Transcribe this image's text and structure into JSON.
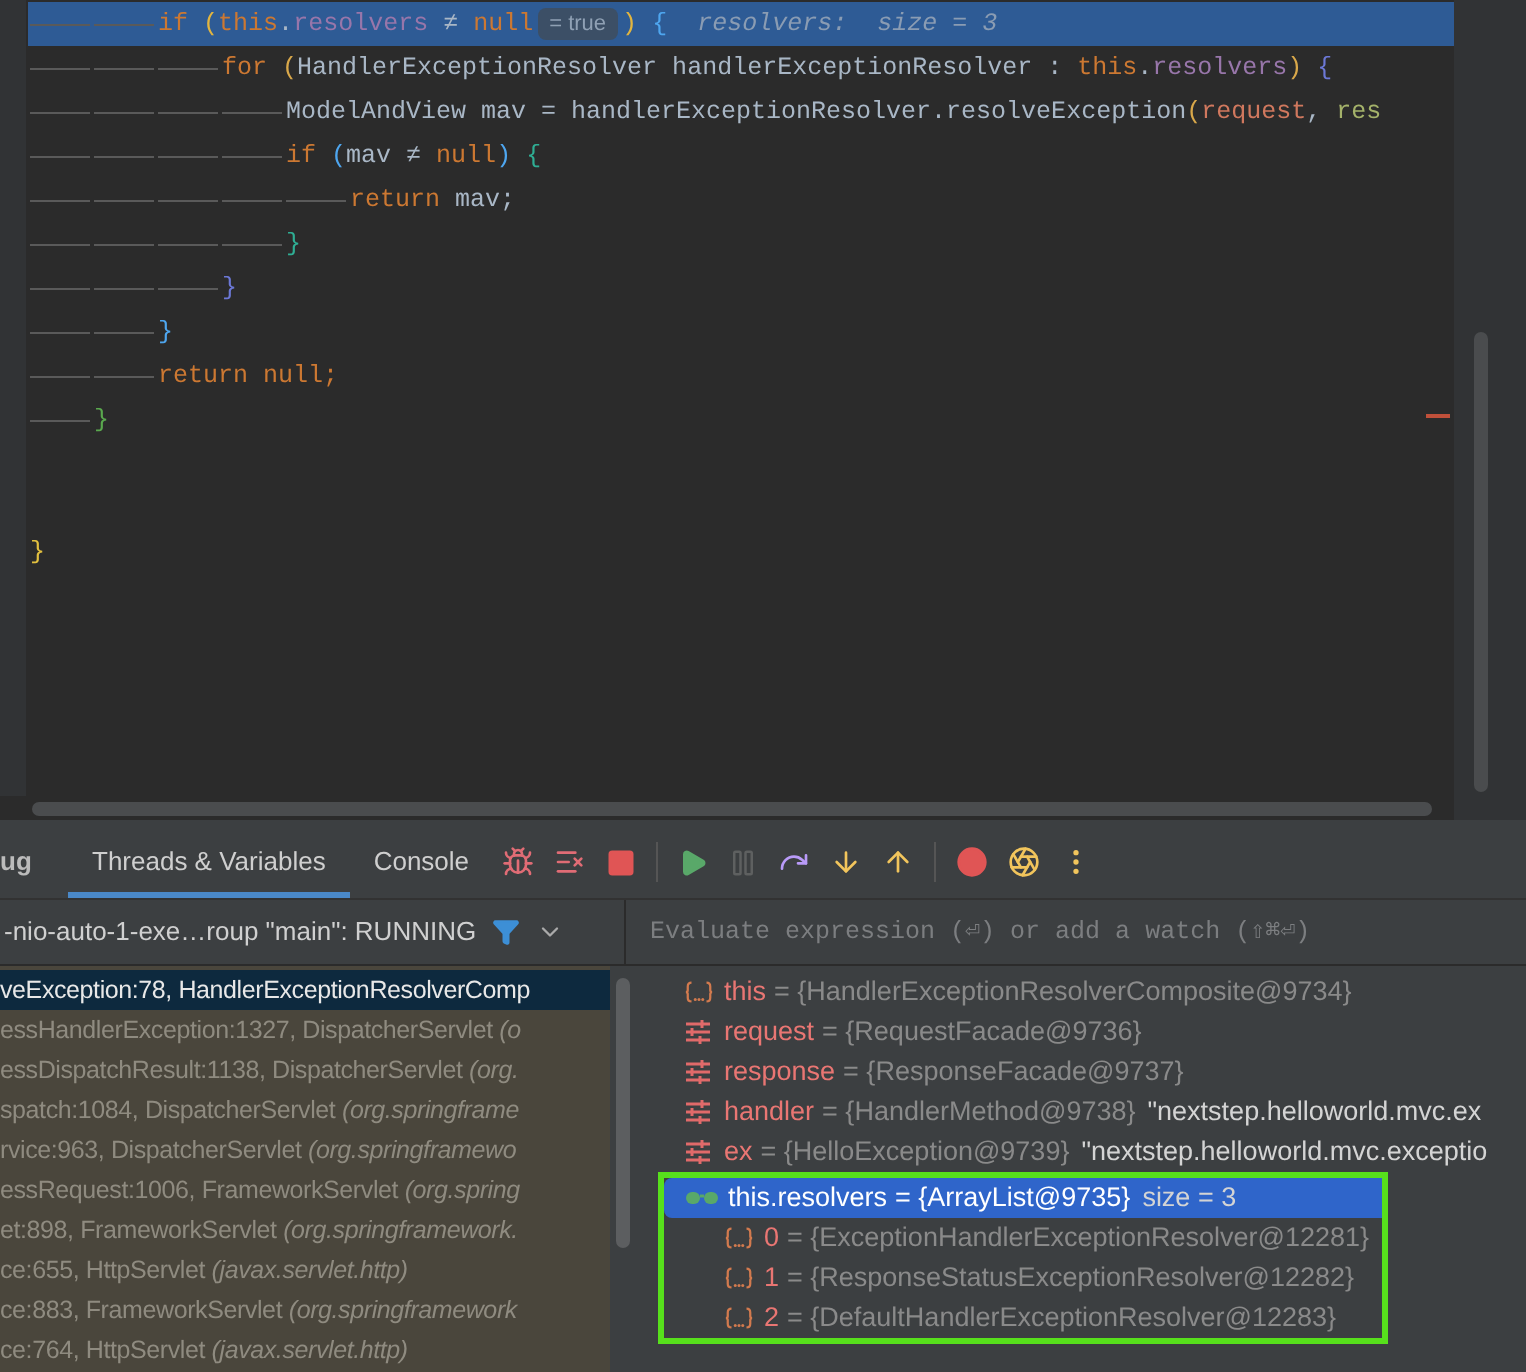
{
  "editor": {
    "lines": [
      {
        "children": [
          {
            "children": [
              {
                "highlighted": true,
                "tokens": [
                  {
                    "kind": "keyword",
                    "text": "if "
                  },
                  {
                    "kind": "bracket",
                    "text": "(",
                    "color": "#e2b53f"
                  },
                  {
                    "kind": "keyword",
                    "text": "this"
                  },
                  {
                    "kind": "plain",
                    "text": "."
                  },
                  {
                    "kind": "field",
                    "text": "resolvers"
                  },
                  {
                    "kind": "plain",
                    "text": " ≠ "
                  },
                  {
                    "kind": "keyword",
                    "text": "null"
                  },
                  {
                    "kind": "hint",
                    "text": "= true"
                  },
                  {
                    "kind": "bracket",
                    "text": ")",
                    "color": "#e2b53f"
                  },
                  {
                    "kind": "bracket",
                    "text": " {",
                    "color": "#4ea6ef"
                  },
                  {
                    "kind": "inline-value",
                    "text": "  resolvers:  size = 3"
                  }
                ],
                "children": [
                  {
                    "highlighted": false,
                    "tokens": [
                      {
                        "kind": "keyword",
                        "text": "for "
                      },
                      {
                        "kind": "bracket",
                        "text": "(",
                        "color": "#d9a84a"
                      },
                      {
                        "kind": "plain",
                        "text": "HandlerExceptionResolver handlerExceptionResolver : "
                      },
                      {
                        "kind": "keyword",
                        "text": "this"
                      },
                      {
                        "kind": "plain",
                        "text": "."
                      },
                      {
                        "kind": "field",
                        "text": "resolvers"
                      },
                      {
                        "kind": "bracket",
                        "text": ")",
                        "color": "#d9a84a"
                      },
                      {
                        "kind": "bracket",
                        "text": " {",
                        "color": "#6c78d6"
                      }
                    ],
                    "children": [
                      {
                        "highlighted": false,
                        "tokens": [
                          {
                            "kind": "plain",
                            "text": "ModelAndView mav = handlerExceptionResolver.resolveException"
                          },
                          {
                            "kind": "bracket",
                            "text": "(",
                            "color": "#d9a84a"
                          },
                          {
                            "kind": "param",
                            "text": "request"
                          },
                          {
                            "kind": "plain",
                            "text": ", "
                          },
                          {
                            "kind": "param-alt",
                            "text": "res"
                          }
                        ]
                      },
                      {
                        "highlighted": false,
                        "tokens": [
                          {
                            "kind": "keyword",
                            "text": "if "
                          },
                          {
                            "kind": "bracket",
                            "text": "(",
                            "color": "#4ea6ef"
                          },
                          {
                            "kind": "plain",
                            "text": "mav ≠ "
                          },
                          {
                            "kind": "keyword",
                            "text": "null"
                          },
                          {
                            "kind": "bracket",
                            "text": ")",
                            "color": "#4ea6ef"
                          },
                          {
                            "kind": "bracket",
                            "text": " {",
                            "color": "#2fae94"
                          }
                        ],
                        "children": [
                          {
                            "highlighted": false,
                            "tokens": [
                              {
                                "kind": "keyword",
                                "text": "return"
                              },
                              {
                                "kind": "plain",
                                "text": " mav;"
                              }
                            ]
                          }
                        ]
                      },
                      {
                        "highlighted": false,
                        "tokens": [
                          {
                            "kind": "bracket",
                            "text": "}",
                            "color": "#2fae94"
                          }
                        ]
                      }
                    ]
                  },
                  {
                    "highlighted": false,
                    "tokens": [
                      {
                        "kind": "bracket",
                        "text": "}",
                        "color": "#6c78d6"
                      }
                    ]
                  }
                ]
              },
              {
                "highlighted": false,
                "tokens": [
                  {
                    "kind": "bracket",
                    "text": "}",
                    "color": "#4ea6ef"
                  }
                ]
              },
              {
                "highlighted": false,
                "tokens": [
                  {
                    "kind": "keyword",
                    "text": "return null;"
                  }
                ]
              }
            ]
          },
          {
            "highlighted": false,
            "tokens": [
              {
                "kind": "bracket",
                "text": "}",
                "color": "#5aa84e"
              }
            ]
          }
        ]
      },
      {
        "kind": "blank"
      },
      {
        "kind": "blank"
      },
      {
        "highlighted": false,
        "tokens": [
          {
            "kind": "bracket",
            "text": "}",
            "color": "#e2c03f"
          }
        ]
      }
    ]
  },
  "debug": {
    "title": "ug",
    "tabs": [
      {
        "label": "Threads & Variables",
        "selected": true
      },
      {
        "label": "Console",
        "selected": false
      }
    ],
    "thread": "-nio-auto-1-exe…roup \"main\": RUNNING",
    "evaluate": {
      "placeholder": "Evaluate expression (⏎) or add a watch (⇧⌘⏎)"
    },
    "frames": [
      {
        "selected": true,
        "location": "veException:78, HandlerExceptionResolverComp"
      },
      {
        "selected": false,
        "location": "essHandlerException:1327, DispatcherServlet ",
        "package": "(o"
      },
      {
        "selected": false,
        "location": "essDispatchResult:1138, DispatcherServlet ",
        "package": "(org."
      },
      {
        "selected": false,
        "location": "spatch:1084, DispatcherServlet ",
        "package": "(org.springframe"
      },
      {
        "selected": false,
        "location": "rvice:963, DispatcherServlet ",
        "package": "(org.springframewo"
      },
      {
        "selected": false,
        "location": "essRequest:1006, FrameworkServlet ",
        "package": "(org.spring"
      },
      {
        "selected": false,
        "location": "et:898, FrameworkServlet ",
        "package": "(org.springframework."
      },
      {
        "selected": false,
        "location": "ce:655, HttpServlet ",
        "package": "(javax.servlet.http)"
      },
      {
        "selected": false,
        "location": "ce:883, FrameworkServlet ",
        "package": "(org.springframework"
      },
      {
        "selected": false,
        "location": "ce:764, HttpServlet ",
        "package": "(javax.servlet.http)"
      }
    ],
    "variables": [
      {
        "kind": "object",
        "selected": false,
        "name": "this",
        "value": "= {HandlerExceptionResolverComposite@9734}"
      },
      {
        "kind": "param",
        "selected": false,
        "name": "request",
        "value": "= {RequestFacade@9736}"
      },
      {
        "kind": "param",
        "selected": false,
        "name": "response",
        "value": "= {ResponseFacade@9737}"
      },
      {
        "kind": "param",
        "selected": false,
        "name": "handler",
        "value": "= {HandlerMethod@9738}",
        "extra": "\"nextstep.helloworld.mvc.ex"
      },
      {
        "kind": "param",
        "selected": false,
        "name": "ex",
        "value": "= {HelloException@9739}",
        "extra": "\"nextstep.helloworld.mvc.exceptio"
      },
      {
        "kind": "watch",
        "selected": true,
        "name": "this.resolvers",
        "value": "= {ArrayList@9735}",
        "extra": "size = 3",
        "children": [
          {
            "kind": "object",
            "selected": false,
            "name": "0",
            "value": "= {ExceptionHandlerExceptionResolver@12281}"
          },
          {
            "kind": "object",
            "selected": false,
            "name": "1",
            "value": "= {ResponseStatusExceptionResolver@12282}"
          },
          {
            "kind": "object",
            "selected": false,
            "name": "2",
            "value": "= {DefaultHandlerExceptionResolver@12283}"
          }
        ]
      }
    ]
  }
}
